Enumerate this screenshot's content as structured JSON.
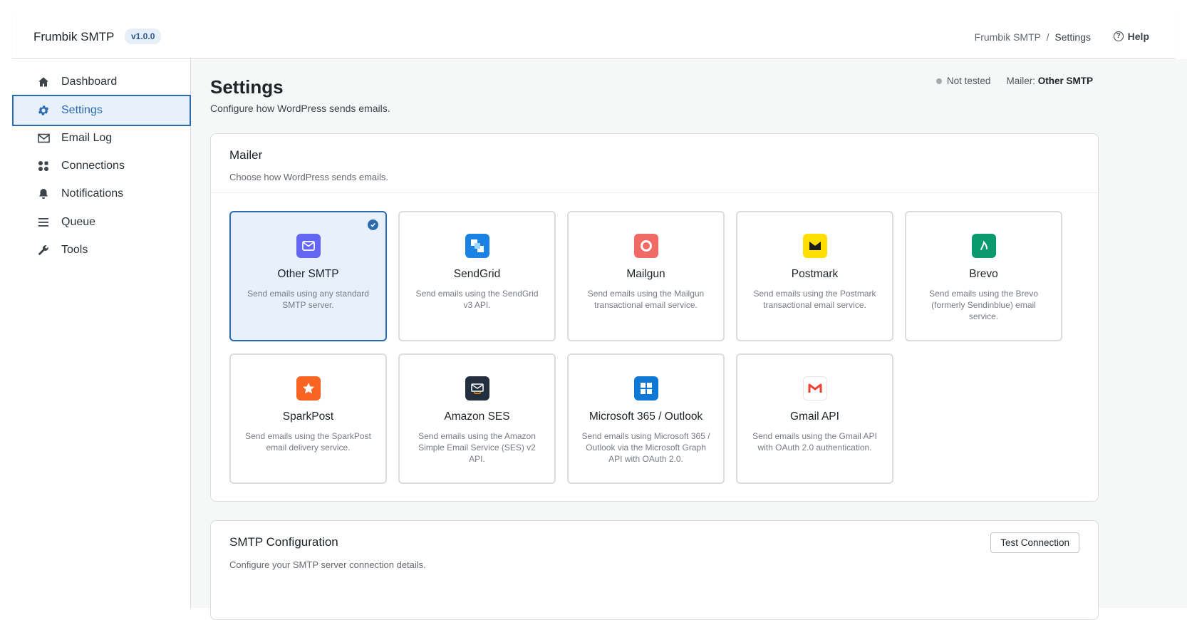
{
  "header": {
    "brand": "Frumbik SMTP",
    "version": "v1.0.0",
    "breadcrumb_root": "Frumbik SMTP",
    "breadcrumb_sep": "/",
    "breadcrumb_current": "Settings",
    "help_label": "Help"
  },
  "sidebar": {
    "items": [
      {
        "label": "Dashboard",
        "icon": "home-icon"
      },
      {
        "label": "Settings",
        "icon": "gear-icon",
        "active": true
      },
      {
        "label": "Email Log",
        "icon": "envelope-icon"
      },
      {
        "label": "Connections",
        "icon": "grid-dots-icon"
      },
      {
        "label": "Notifications",
        "icon": "bell-icon"
      },
      {
        "label": "Queue",
        "icon": "list-icon"
      },
      {
        "label": "Tools",
        "icon": "wrench-icon"
      }
    ]
  },
  "page": {
    "title": "Settings",
    "subtitle": "Configure how WordPress sends emails.",
    "status_text": "Not tested",
    "mailer_label": "Mailer:",
    "mailer_value": "Other SMTP"
  },
  "mailer_card": {
    "title": "Mailer",
    "subtitle": "Choose how WordPress sends emails.",
    "options": [
      {
        "name": "Other SMTP",
        "desc": "Send emails using any standard SMTP server.",
        "color": "#6366f1",
        "icon": "envelope-icon",
        "selected": true
      },
      {
        "name": "SendGrid",
        "desc": "Send emails using the SendGrid v3 API.",
        "color": "#1a82e2",
        "icon": "sendgrid-icon"
      },
      {
        "name": "Mailgun",
        "desc": "Send emails using the Mailgun transactional email service.",
        "color": "#f06b66",
        "icon": "mailgun-icon"
      },
      {
        "name": "Postmark",
        "desc": "Send emails using the Postmark transactional email service.",
        "color": "#ffde00",
        "icon": "postmark-icon"
      },
      {
        "name": "Brevo",
        "desc": "Send emails using the Brevo (formerly Sendinblue) email service.",
        "color": "#0b996e",
        "icon": "brevo-icon"
      },
      {
        "name": "SparkPost",
        "desc": "Send emails using the SparkPost email delivery service.",
        "color": "#fa6423",
        "icon": "star-icon"
      },
      {
        "name": "Amazon SES",
        "desc": "Send emails using the Amazon Simple Email Service (SES) v2 API.",
        "color": "#232f3e",
        "icon": "amazon-icon"
      },
      {
        "name": "Microsoft 365 / Outlook",
        "desc": "Send emails using Microsoft 365 / Outlook via the Microsoft Graph API with OAuth 2.0.",
        "color": "#0f78d4",
        "icon": "windows-icon"
      },
      {
        "name": "Gmail API",
        "desc": "Send emails using the Gmail API with OAuth 2.0 authentication.",
        "color": "#ffffff",
        "icon": "gmail-icon"
      }
    ]
  },
  "smtp_card": {
    "title": "SMTP Configuration",
    "subtitle": "Configure your SMTP server connection details.",
    "test_button": "Test Connection"
  }
}
